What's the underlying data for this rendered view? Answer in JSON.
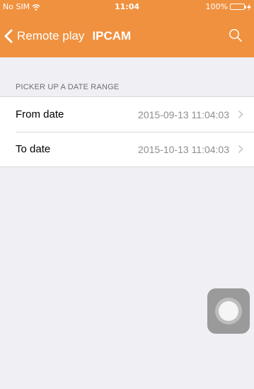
{
  "status_bar": {
    "carrier": "No SIM",
    "time": "11:04",
    "battery": "100%",
    "wifi_icon": "wifi-icon",
    "battery_icon": "battery-charging-icon"
  },
  "nav": {
    "back_label": "Remote play",
    "title": "IPCAM",
    "back_icon": "chevron-left-icon",
    "search_icon": "search-icon"
  },
  "section": {
    "header": "PICKER UP A DATE RANGE"
  },
  "rows": [
    {
      "label": "From date",
      "value": "2015-09-13 11:04:03"
    },
    {
      "label": "To date",
      "value": "2015-10-13 11:04:03"
    }
  ],
  "colors": {
    "accent": "#f0913f",
    "background": "#efeff4",
    "secondary_text": "#8e8e93",
    "battery_fill": "#4cd964"
  }
}
